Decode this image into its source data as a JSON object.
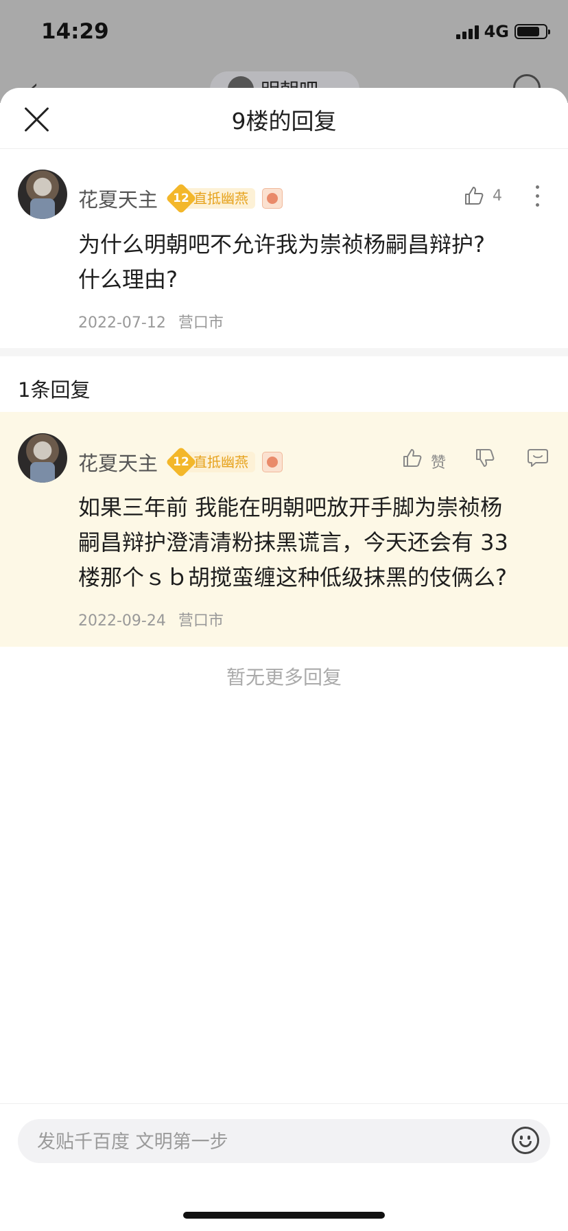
{
  "status_bar": {
    "time": "14:29",
    "network": "4G",
    "battery_pct": 80
  },
  "underlying": {
    "forum_name": "明朝吧"
  },
  "sheet": {
    "title": "9楼的回复"
  },
  "post": {
    "username": "花夏天主",
    "level": "12",
    "badge_title": "直抵幽燕",
    "like_count": "4",
    "content_line1": "为什么明朝吧不允许我为崇祯杨嗣昌辩护?",
    "content_line2": "什么理由?",
    "date": "2022-07-12",
    "location": "营口市"
  },
  "replies_header": "1条回复",
  "reply": {
    "username": "花夏天主",
    "level": "12",
    "badge_title": "直抵幽燕",
    "like_label": "赞",
    "content_line1": "如果三年前 我能在明朝吧放开手脚为崇祯杨",
    "content_line2": "嗣昌辩护澄清清粉抹黑谎言，今天还会有 33",
    "content_line3": "楼那个ｓｂ胡搅蛮缠这种低级抹黑的伎俩么?",
    "date": "2022-09-24",
    "location": "营口市"
  },
  "no_more_text": "暂无更多回复",
  "input": {
    "placeholder": "发贴千百度 文明第一步"
  },
  "icons": {
    "close": "close-icon",
    "like": "thumbs-up-icon",
    "dislike": "thumbs-down-icon",
    "comment": "comment-icon",
    "more": "more-vertical-icon",
    "emoji": "smile-icon"
  }
}
